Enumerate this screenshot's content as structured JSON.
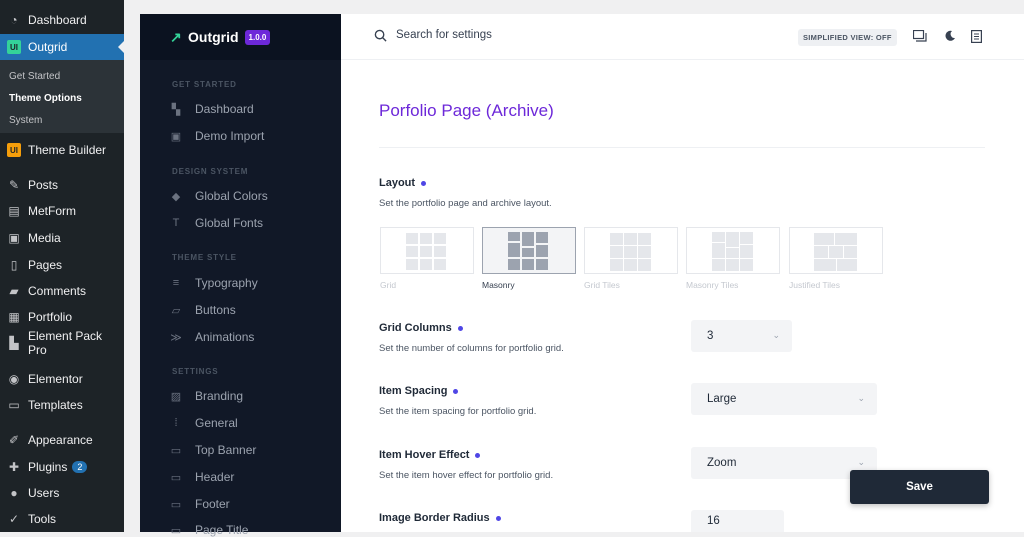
{
  "wp_sidebar": {
    "items": [
      {
        "label": "Dashboard",
        "icon": "dashboard-icon"
      },
      {
        "label": "Outgrid",
        "icon": "outgrid-icon"
      },
      {
        "label": "Theme Builder",
        "icon": "theme-builder-icon"
      },
      {
        "label": "Posts",
        "icon": "pin-icon"
      },
      {
        "label": "MetForm",
        "icon": "metform-icon"
      },
      {
        "label": "Media",
        "icon": "media-icon"
      },
      {
        "label": "Pages",
        "icon": "pages-icon"
      },
      {
        "label": "Comments",
        "icon": "comments-icon"
      },
      {
        "label": "Portfolio",
        "icon": "portfolio-icon"
      },
      {
        "label": "Element Pack Pro",
        "icon": "element-pack-icon"
      },
      {
        "label": "Elementor",
        "icon": "elementor-icon"
      },
      {
        "label": "Templates",
        "icon": "folder-icon"
      },
      {
        "label": "Appearance",
        "icon": "brush-icon"
      },
      {
        "label": "Plugins",
        "icon": "plugin-icon",
        "badge": "2"
      },
      {
        "label": "Users",
        "icon": "user-icon"
      },
      {
        "label": "Tools",
        "icon": "wrench-icon"
      }
    ],
    "submenu": [
      "Get Started",
      "Theme Options",
      "System"
    ]
  },
  "outgrid": {
    "title": "Outgrid",
    "version": "1.0.0",
    "sections": [
      {
        "title": "GET STARTED",
        "items": [
          "Dashboard",
          "Demo Import"
        ]
      },
      {
        "title": "DESIGN SYSTEM",
        "items": [
          "Global Colors",
          "Global Fonts"
        ]
      },
      {
        "title": "THEME STYLE",
        "items": [
          "Typography",
          "Buttons",
          "Animations"
        ]
      },
      {
        "title": "SETTINGS",
        "items": [
          "Branding",
          "General",
          "Top Banner",
          "Header",
          "Footer",
          "Page Title"
        ]
      }
    ]
  },
  "topbar": {
    "search_placeholder": "Search for settings",
    "simplified_view": "SIMPLIFIED VIEW: OFF"
  },
  "page": {
    "title": "Porfolio Page (Archive)",
    "layout": {
      "label": "Layout",
      "desc": "Set the portfolio page and archive layout.",
      "options": [
        "Grid",
        "Masonry",
        "Grid Tiles",
        "Masonry Tiles",
        "Justified Tiles"
      ],
      "selected": "Masonry"
    },
    "grid_columns": {
      "label": "Grid Columns",
      "desc": "Set the number of columns for portfolio grid.",
      "value": "3"
    },
    "item_spacing": {
      "label": "Item Spacing",
      "desc": "Set the item spacing for portfolio grid.",
      "value": "Large"
    },
    "hover_effect": {
      "label": "Item Hover Effect",
      "desc": "Set the item hover effect for portfolio grid.",
      "value": "Zoom"
    },
    "border_radius": {
      "label": "Image Border Radius",
      "value": "16"
    }
  },
  "save_label": "Save",
  "colors": {
    "accent": "#6d28d9",
    "wp_active": "#2271b1",
    "dot": "#4f46e5"
  }
}
